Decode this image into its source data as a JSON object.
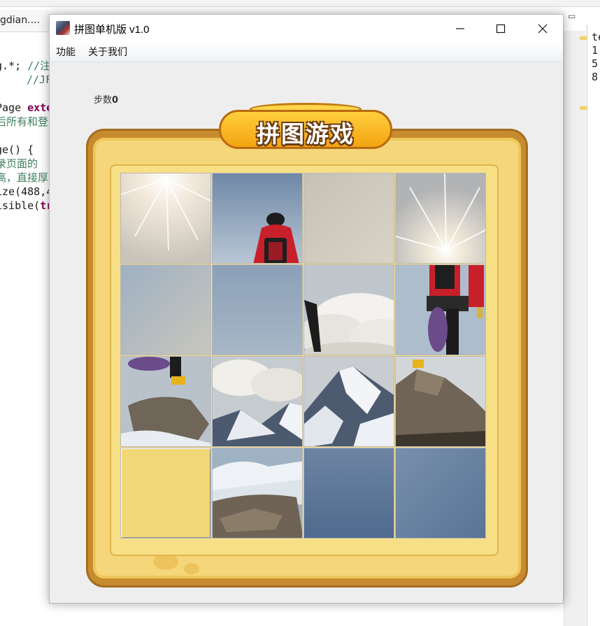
{
  "ide": {
    "tab_label": "gdian....",
    "code_lines": [
      {
        "text": "g.*;",
        "extra": " //注"
      },
      {
        "text": "",
        "extra": "//JF"
      },
      {
        "text": "Page ",
        "extra": "exte"
      },
      {
        "text": "",
        "extra": "后所有和登"
      },
      {
        "text": "ge() {",
        "extra": ""
      },
      {
        "text": "",
        "extra": "录页面的"
      },
      {
        "text": "",
        "extra": "高，直接厚"
      },
      {
        "text": "ize(488,4",
        "extra": ""
      },
      {
        "text": "isible(",
        "extra": "tr"
      }
    ],
    "outline_lines": [
      "te",
      "1",
      "5",
      "8"
    ]
  },
  "window": {
    "title": "拼图单机版 v1.0",
    "controls": {
      "minimize_icon": "minimize-icon",
      "maximize_icon": "maximize-icon",
      "close_icon": "close-icon"
    }
  },
  "menu": {
    "items": [
      {
        "label": "功能"
      },
      {
        "label": "关于我们"
      }
    ]
  },
  "game": {
    "step_label": "步数",
    "step_count": "0",
    "banner_title": "拼图游戏",
    "grid_size": 4,
    "tiles": [
      {
        "row": 0,
        "col": 0,
        "content": "sky-sunburst"
      },
      {
        "row": 0,
        "col": 1,
        "content": "climber-red-jacket-back"
      },
      {
        "row": 0,
        "col": 2,
        "content": "sky-plain"
      },
      {
        "row": 0,
        "col": 3,
        "content": "sun-rays"
      },
      {
        "row": 1,
        "col": 0,
        "content": "sky-blue"
      },
      {
        "row": 1,
        "col": 1,
        "content": "sky-blue"
      },
      {
        "row": 1,
        "col": 2,
        "content": "clouds-climber-leg"
      },
      {
        "row": 1,
        "col": 3,
        "content": "climber-with-rope"
      },
      {
        "row": 2,
        "col": 0,
        "content": "climber-boot-rock"
      },
      {
        "row": 2,
        "col": 1,
        "content": "clouds-ridge"
      },
      {
        "row": 2,
        "col": 2,
        "content": "snow-peak"
      },
      {
        "row": 2,
        "col": 3,
        "content": "rocky-outcrop"
      },
      {
        "row": 3,
        "col": 0,
        "content": "empty"
      },
      {
        "row": 3,
        "col": 1,
        "content": "snow-rocks"
      },
      {
        "row": 3,
        "col": 2,
        "content": "sky-deep-blue"
      },
      {
        "row": 3,
        "col": 3,
        "content": "sky-deep-blue"
      }
    ]
  },
  "colors": {
    "frame_outer": "#c78a2e",
    "frame_inner": "#f5d67a",
    "banner": "#f3a411",
    "empty_tile": "#f2d777"
  }
}
